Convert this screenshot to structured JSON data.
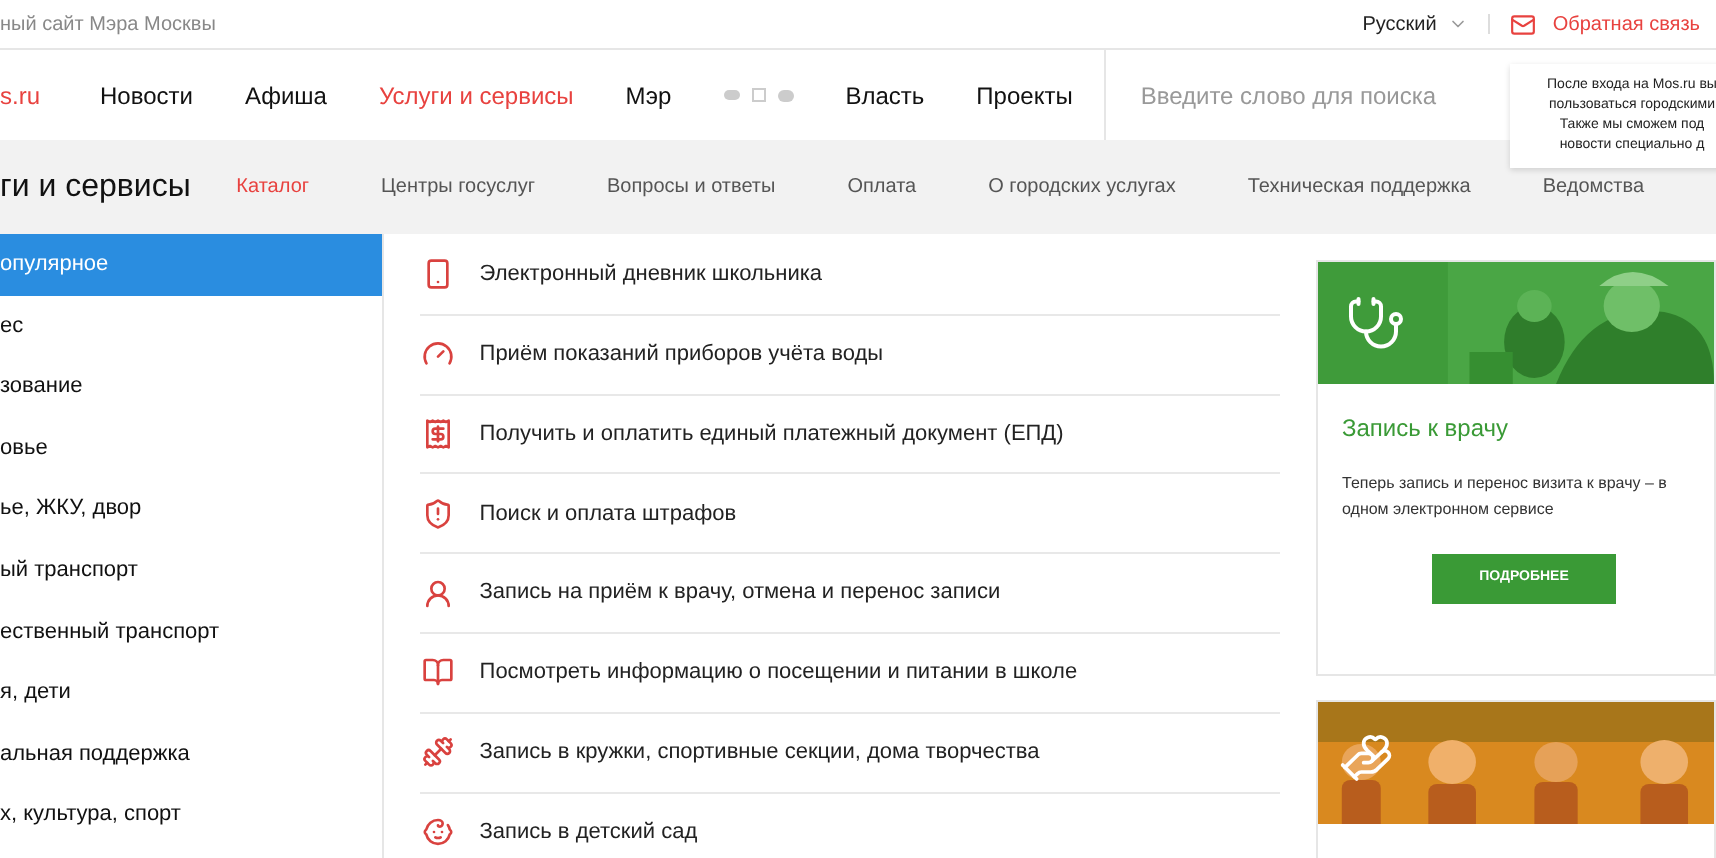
{
  "top_bar": {
    "site_caption": "ный сайт Мэра Москвы",
    "language": "Русский",
    "feedback": "Обратная связь"
  },
  "nav": {
    "logo": "s.ru",
    "items": [
      {
        "label": "Новости",
        "selected": false
      },
      {
        "label": "Афиша",
        "selected": false
      },
      {
        "label": "Услуги и сервисы",
        "selected": true
      },
      {
        "label": "Мэр",
        "selected": false
      },
      {
        "label": "Власть",
        "selected": false
      },
      {
        "label": "Проекты",
        "selected": false
      }
    ],
    "search": {
      "placeholder": "Введите слово для поиска"
    }
  },
  "login_popup": {
    "lines": [
      "После входа на Mos.ru вы",
      "пользоваться городскими",
      "Также мы сможем под",
      "новости специально д"
    ]
  },
  "section": {
    "title": "ги и сервисы",
    "tabs": [
      {
        "label": "Каталог",
        "selected": true
      },
      {
        "label": "Центры госуслуг",
        "selected": false
      },
      {
        "label": "Вопросы и ответы",
        "selected": false
      },
      {
        "label": "Оплата",
        "selected": false
      },
      {
        "label": "О городских услугах",
        "selected": false
      },
      {
        "label": "Техническая поддержка",
        "selected": false
      },
      {
        "label": "Ведомства",
        "selected": false
      }
    ]
  },
  "sidebar": {
    "items": [
      {
        "label": "опулярное",
        "selected": true
      },
      {
        "label": "ес",
        "selected": false
      },
      {
        "label": "зование",
        "selected": false
      },
      {
        "label": "овье",
        "selected": false
      },
      {
        "label": "ье, ЖКУ, двор",
        "selected": false
      },
      {
        "label": "ый транспорт",
        "selected": false
      },
      {
        "label": "ественный транспорт",
        "selected": false
      },
      {
        "label": "я, дети",
        "selected": false
      },
      {
        "label": "альная поддержка",
        "selected": false
      },
      {
        "label": "х, культура, спорт",
        "selected": false
      }
    ]
  },
  "services": [
    {
      "kind": "phone",
      "label": "Электронный дневник школьника"
    },
    {
      "kind": "meter",
      "label": "Приём показаний приборов учёта воды"
    },
    {
      "kind": "receipt",
      "label": "Получить и оплатить единый платежный документ (ЕПД)"
    },
    {
      "kind": "cap",
      "label": "Поиск и оплата штрафов"
    },
    {
      "kind": "doctor",
      "label": "Запись на приём к врачу, отмена и перенос записи"
    },
    {
      "kind": "book",
      "label": "Посмотреть информацию о посещении и питании в школе"
    },
    {
      "kind": "sport",
      "label": "Запись в кружки, спортивные секции, дома творчества"
    },
    {
      "kind": "baby",
      "label": "Запись в детский сад"
    }
  ],
  "cards": [
    {
      "kind": "doctor",
      "title": "Запись к врачу",
      "text": "Теперь запись и перенос визита к врачу – в одном электронном сервисе",
      "button": "ПОДРОБНЕЕ"
    },
    {
      "kind": "family"
    }
  ]
}
